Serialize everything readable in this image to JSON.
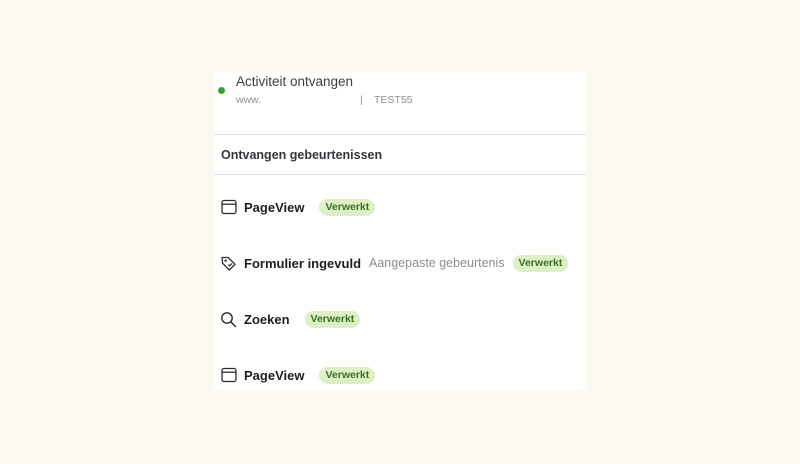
{
  "status": {
    "title": "Activiteit ontvangen",
    "url": "www.",
    "separator": "|",
    "code": "TEST55",
    "dot_color": "#3f9d3a"
  },
  "section": {
    "title": "Ontvangen gebeurtenissen"
  },
  "badge_style": {
    "background": "#dcefc5",
    "text_color": "#3d6f21"
  },
  "events": [
    {
      "icon": "browser-window-icon",
      "name": "PageView",
      "subtitle": "",
      "badge": "Verwerkt"
    },
    {
      "icon": "tag-icon",
      "name": "Formulier ingevuld",
      "subtitle": "Aangepaste gebeurtenis",
      "badge": "Verwerkt"
    },
    {
      "icon": "search-icon",
      "name": "Zoeken",
      "subtitle": "",
      "badge": "Verwerkt"
    },
    {
      "icon": "browser-window-icon",
      "name": "PageView",
      "subtitle": "",
      "badge": "Verwerkt"
    }
  ]
}
